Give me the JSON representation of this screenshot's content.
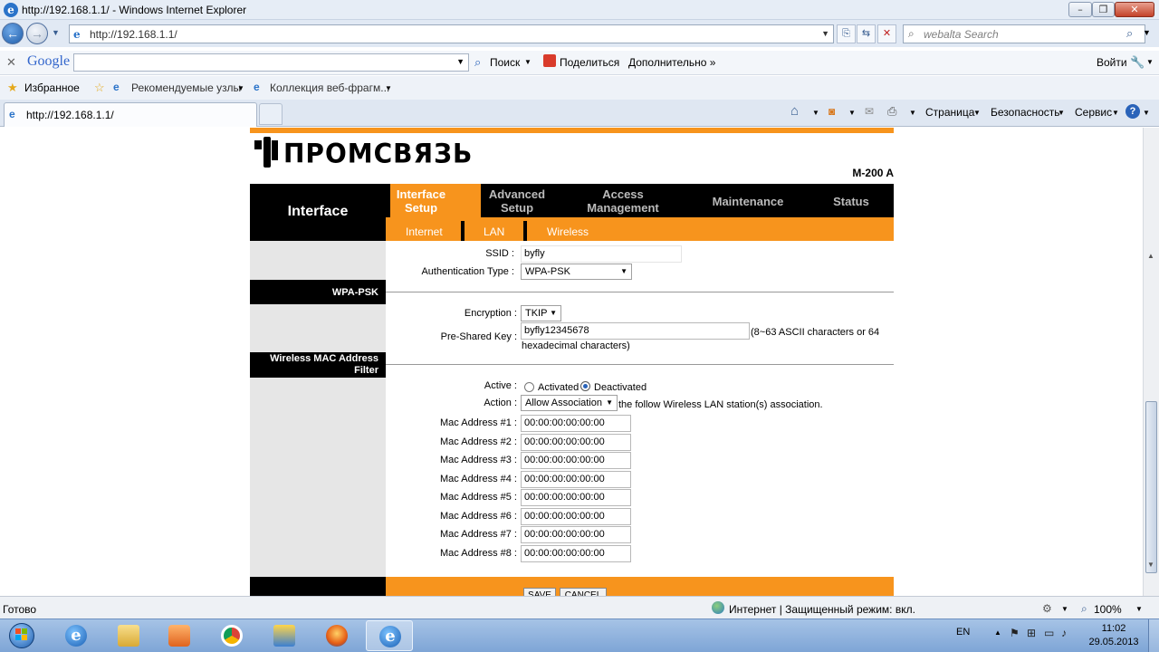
{
  "window": {
    "title": "http://192.168.1.1/ - Windows Internet Explorer"
  },
  "address": {
    "url": "http://192.168.1.1/",
    "search_placeholder": "webalta Search"
  },
  "google_toolbar": {
    "logo": "Google",
    "search_label": "Поиск",
    "share_label": "Поделиться",
    "more_label": "Дополнительно »",
    "login_label": "Войти"
  },
  "favorites": {
    "favorites_label": "Избранное",
    "items": [
      "Рекомендуемые узлы",
      "Коллекция веб-фрагм..."
    ]
  },
  "tabs": {
    "active_label": "http://192.168.1.1/"
  },
  "command_bar": {
    "page": "Страница",
    "safety": "Безопасность",
    "tools": "Сервис"
  },
  "router": {
    "brand": "ПРОМСВЯЗЬ",
    "model": "M-200 A",
    "section_title": "Interface",
    "menu": [
      "Interface Setup",
      "Advanced Setup",
      "Access Management",
      "Maintenance",
      "Status"
    ],
    "submenu": [
      "Internet",
      "LAN",
      "Wireless"
    ],
    "ssid_label": "SSID :",
    "ssid_value": "byfly",
    "auth_label": "Authentication Type :",
    "auth_value": "WPA-PSK",
    "wpa_section": "WPA-PSK",
    "encryption_label": "Encryption :",
    "encryption_value": "TKIP",
    "psk_label": "Pre-Shared Key :",
    "psk_value": "byfly12345678",
    "psk_hint1": "(8~63 ASCII characters or 64",
    "psk_hint2": "hexadecimal characters)",
    "mac_section_line1": "Wireless MAC Address",
    "mac_section_line2": "Filter",
    "active_label": "Active :",
    "activated": "Activated",
    "deactivated": "Deactivated",
    "active_selected": "Deactivated",
    "action_label": "Action :",
    "action_value": "Allow Association",
    "action_suffix": "the follow Wireless LAN station(s) association.",
    "mac_addresses": [
      {
        "label": "Mac Address #1 :",
        "value": "00:00:00:00:00:00"
      },
      {
        "label": "Mac Address #2 :",
        "value": "00:00:00:00:00:00"
      },
      {
        "label": "Mac Address #3 :",
        "value": "00:00:00:00:00:00"
      },
      {
        "label": "Mac Address #4 :",
        "value": "00:00:00:00:00:00"
      },
      {
        "label": "Mac Address #5 :",
        "value": "00:00:00:00:00:00"
      },
      {
        "label": "Mac Address #6 :",
        "value": "00:00:00:00:00:00"
      },
      {
        "label": "Mac Address #7 :",
        "value": "00:00:00:00:00:00"
      },
      {
        "label": "Mac Address #8 :",
        "value": "00:00:00:00:00:00"
      }
    ],
    "save_label": "SAVE",
    "cancel_label": "CANCEL"
  },
  "statusbar": {
    "left": "Готово",
    "zone": "Интернет | Защищенный режим: вкл.",
    "zoom": "100%"
  },
  "taskbar": {
    "lang": "EN",
    "time": "11:02",
    "date": "29.05.2013"
  },
  "colors": {
    "orange": "#f7941d",
    "black": "#000000",
    "panel_gray": "#e6e6e6"
  }
}
